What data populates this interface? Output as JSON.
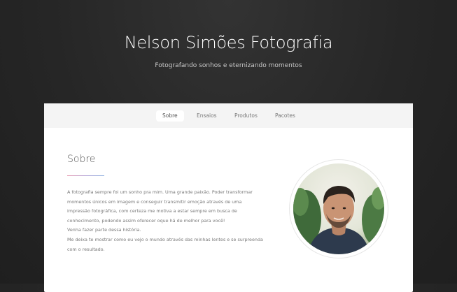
{
  "header": {
    "title": "Nelson Simões Fotografia",
    "tagline": "Fotografando sonhos e eternizando momentos"
  },
  "nav": {
    "items": [
      {
        "label": "Sobre",
        "active": true
      },
      {
        "label": "Ensaios",
        "active": false
      },
      {
        "label": "Produtos",
        "active": false
      },
      {
        "label": "Pacotes",
        "active": false
      }
    ]
  },
  "about": {
    "title": "Sobre",
    "underline_colors": [
      "#e89ab0",
      "#b3a3d6",
      "#8fb2e0"
    ],
    "lines": [
      "A fotografia sempre foi um sonho pra mim. Uma grande paixão. Poder transformar",
      "momentos únicos em imagem e conseguir transmitir emoção através de uma",
      "impressão fotográfica, com certeza me motiva a estar sempre em busca de",
      "conhecimento, podendo assim oferecer oque há de melhor para você!",
      "Venha fazer parte dessa história.",
      "Me deixa te mostrar como eu vejo o mundo através das minhas lentes e se surpreenda",
      "com o resultado."
    ]
  },
  "avatar": {
    "icon": "portrait-photo"
  }
}
